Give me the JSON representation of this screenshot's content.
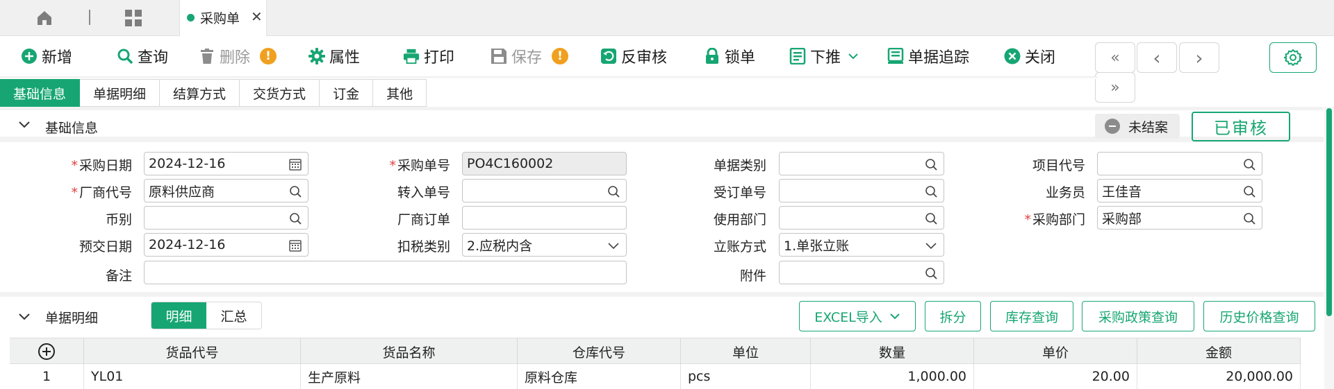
{
  "tab": {
    "title": "采购单",
    "close_glyph": "✕"
  },
  "toolbar": {
    "add": "新增",
    "query": "查询",
    "delete": "删除",
    "properties": "属性",
    "print": "打印",
    "save": "保存",
    "unaudit": "反审核",
    "lock": "锁单",
    "push_down": "下推",
    "trace": "单据追踪",
    "close": "关闭",
    "warn_glyph": "!",
    "nav": {
      "first": "«",
      "prev": "‹",
      "next": "›",
      "last": "»"
    }
  },
  "section_tabs": [
    "基础信息",
    "单据明细",
    "结算方式",
    "交货方式",
    "订金",
    "其他"
  ],
  "basic": {
    "title": "基础信息",
    "status": "未结案",
    "approved": "已审核",
    "required_mark": "*",
    "fields": {
      "purchase_date": {
        "label": "采购日期",
        "value": "2024-12-16"
      },
      "vendor_code": {
        "label": "厂商代号",
        "value": "原料供应商"
      },
      "currency": {
        "label": "币别",
        "value": ""
      },
      "delivery_date": {
        "label": "预交日期",
        "value": "2024-12-16"
      },
      "remark": {
        "label": "备注",
        "value": ""
      },
      "order_no": {
        "label": "采购单号",
        "value": "PO4C160002"
      },
      "transfer_no": {
        "label": "转入单号",
        "value": ""
      },
      "vendor_order": {
        "label": "厂商订单",
        "value": ""
      },
      "tax_type": {
        "label": "扣税类别",
        "value": "2.应税内含"
      },
      "doc_type": {
        "label": "单据类别",
        "value": ""
      },
      "sub_order": {
        "label": "受订单号",
        "value": ""
      },
      "use_dept": {
        "label": "使用部门",
        "value": ""
      },
      "account_method": {
        "label": "立账方式",
        "value": "1.单张立账"
      },
      "attachment": {
        "label": "附件",
        "value": ""
      },
      "project_code": {
        "label": "项目代号",
        "value": ""
      },
      "salesman": {
        "label": "业务员",
        "value": "王佳音"
      },
      "purchase_dept": {
        "label": "采购部门",
        "value": "采购部"
      }
    }
  },
  "detail": {
    "title": "单据明细",
    "sub_tabs": [
      "明细",
      "汇总"
    ],
    "buttons": {
      "excel_import": "EXCEL导入",
      "split": "拆分",
      "stock_query": "库存查询",
      "policy_query": "采购政策查询",
      "price_history": "历史价格查询"
    },
    "columns": [
      "货品代号",
      "货品名称",
      "仓库代号",
      "单位",
      "数量",
      "单价",
      "金额"
    ],
    "rows": [
      {
        "no": "1",
        "item_code": "YL01",
        "item_name": "生产原料",
        "warehouse": "原料仓库",
        "unit": "pcs",
        "qty": "1,000.00",
        "price": "20.00",
        "amount": "20,000.00"
      }
    ]
  },
  "colors": {
    "accent": "#17a673",
    "warning": "#f0a020",
    "required": "#e04040"
  }
}
